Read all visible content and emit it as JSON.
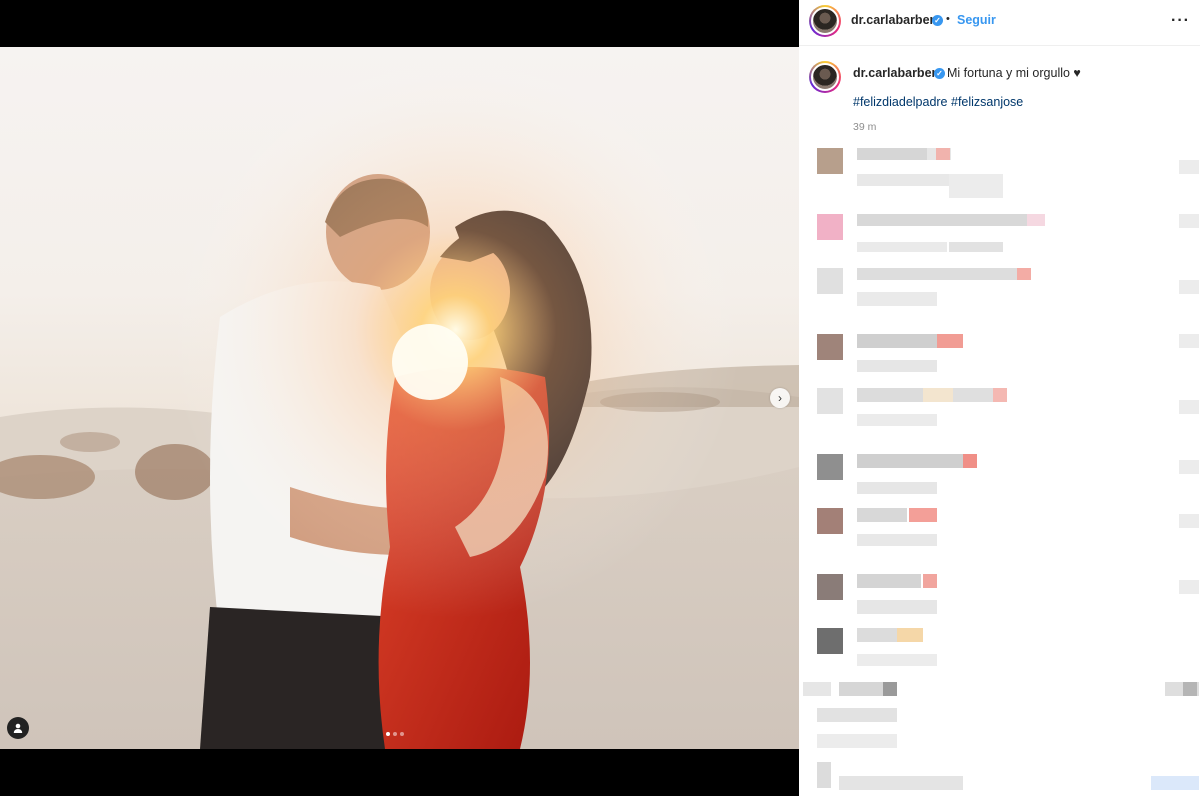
{
  "post": {
    "username": "dr.carlabarber",
    "verified_glyph": "✓",
    "separator": "•",
    "follow_label": "Seguir",
    "more_glyph": "···",
    "caption_text": "Mi fortuna y mi orgullo ♥",
    "hashtags": "#felizdiadelpadre #felizsanjose",
    "timestamp": "39 m"
  },
  "media": {
    "next_glyph": "›",
    "carousel_total": 3,
    "carousel_active": 1
  },
  "colors": {
    "link": "#00376b",
    "follow": "#3897f0",
    "verified": "#3897f0"
  }
}
